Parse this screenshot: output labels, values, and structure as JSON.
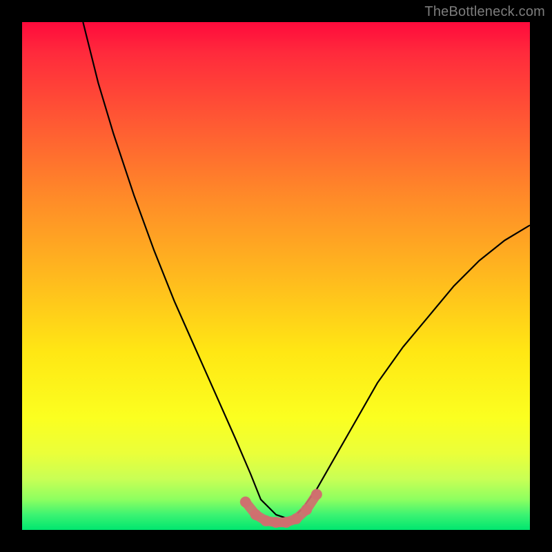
{
  "watermark": "TheBottleneck.com",
  "chart_data": {
    "type": "line",
    "title": "",
    "xlabel": "",
    "ylabel": "",
    "xlim": [
      0,
      100
    ],
    "ylim": [
      0,
      100
    ],
    "grid": false,
    "background_gradient": [
      "#ff0a3c",
      "#ffb91e",
      "#fbff20",
      "#00e66f"
    ],
    "series": [
      {
        "name": "bottleneck-curve",
        "color": "#000000",
        "x": [
          12,
          15,
          18,
          22,
          26,
          30,
          34,
          38,
          42,
          45,
          47,
          50,
          53,
          55,
          58,
          62,
          66,
          70,
          75,
          80,
          85,
          90,
          95,
          100
        ],
        "values": [
          100,
          88,
          78,
          66,
          55,
          45,
          36,
          27,
          18,
          11,
          6,
          3,
          2,
          4,
          8,
          15,
          22,
          29,
          36,
          42,
          48,
          53,
          57,
          60
        ]
      },
      {
        "name": "valley-marker",
        "color": "#cf6f6f",
        "x": [
          44,
          46,
          48,
          50,
          52,
          54,
          56,
          58
        ],
        "values": [
          5.5,
          3.0,
          1.8,
          1.5,
          1.5,
          2.2,
          4.0,
          7.0
        ]
      }
    ]
  }
}
